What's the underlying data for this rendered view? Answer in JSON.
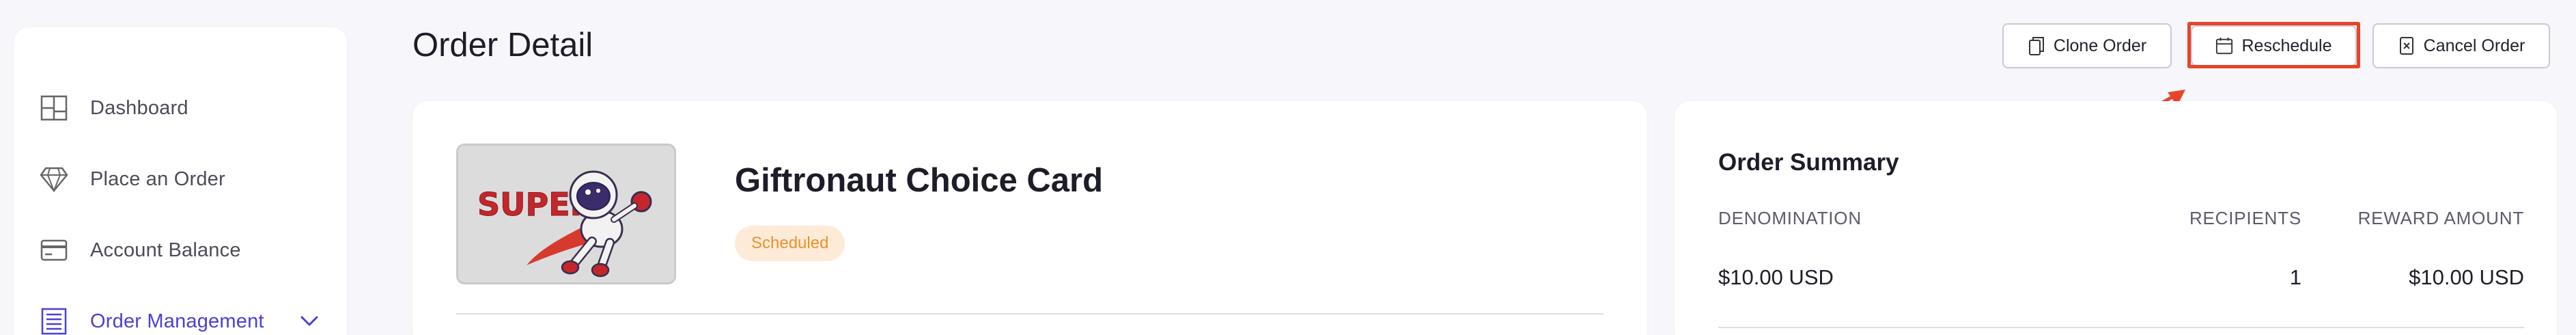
{
  "sidebar": {
    "items": [
      {
        "label": "Dashboard",
        "icon": "dashboard-layout-icon"
      },
      {
        "label": "Place an Order",
        "icon": "diamond-icon"
      },
      {
        "label": "Account Balance",
        "icon": "credit-card-icon"
      },
      {
        "label": "Order Management",
        "icon": "list-document-icon",
        "active": true
      }
    ]
  },
  "header": {
    "title": "Order Detail",
    "buttons": {
      "clone": "Clone Order",
      "reschedule": "Reschedule",
      "cancel": "Cancel Order"
    }
  },
  "product": {
    "name": "Giftronaut Choice Card",
    "status": "Scheduled",
    "image_text": "SUPER!"
  },
  "summary": {
    "title": "Order Summary",
    "columns": [
      "DENOMINATION",
      "RECIPIENTS",
      "REWARD AMOUNT"
    ],
    "values": [
      "$10.00 USD",
      "1",
      "$10.00 USD"
    ]
  },
  "colors": {
    "accent": "#4a3fd6",
    "highlight": "#e8442a",
    "badge_bg": "#fdebd8",
    "badge_text": "#e8922b"
  }
}
